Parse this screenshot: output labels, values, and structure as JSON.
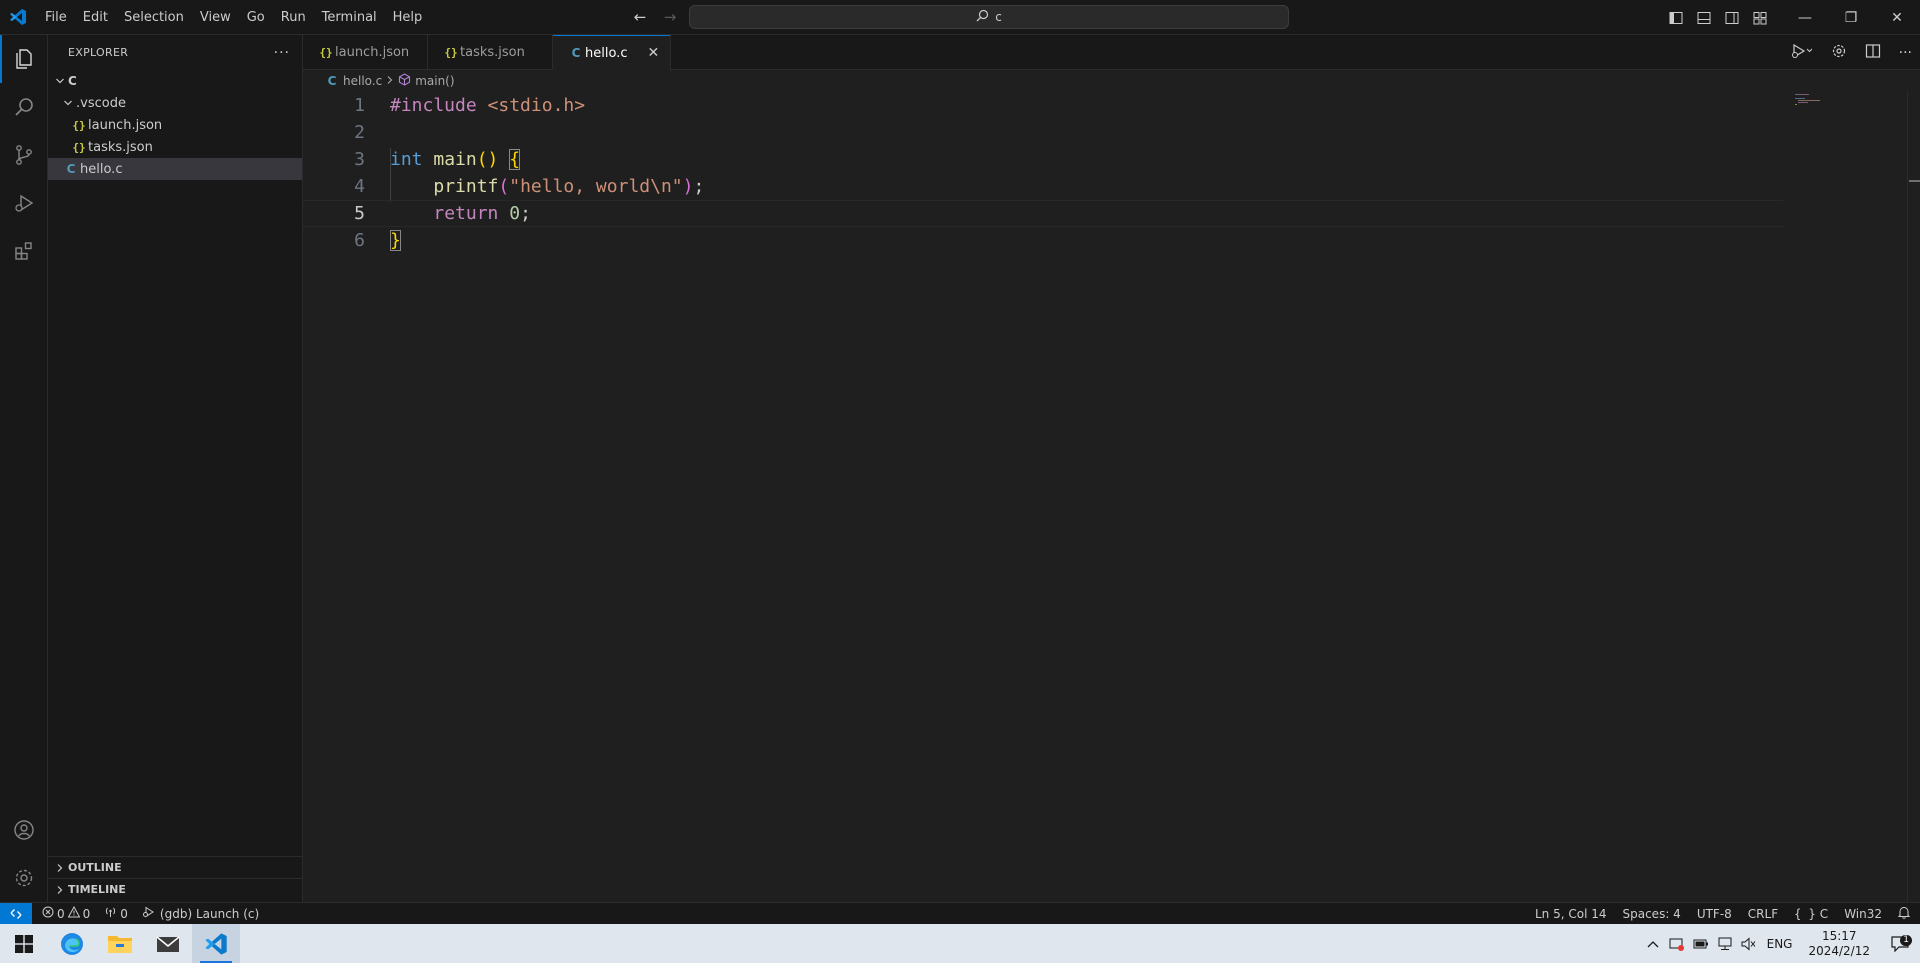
{
  "menu": [
    "File",
    "Edit",
    "Selection",
    "View",
    "Go",
    "Run",
    "Terminal",
    "Help"
  ],
  "search": {
    "value": "c"
  },
  "explorer": {
    "title": "EXPLORER",
    "root": "C",
    "folder": ".vscode",
    "files": [
      "launch.json",
      "tasks.json"
    ],
    "root_file": "hello.c",
    "outline": "OUTLINE",
    "timeline": "TIMELINE"
  },
  "tabs": [
    {
      "label": "launch.json",
      "icon": "json-icon"
    },
    {
      "label": "tasks.json",
      "icon": "json-icon"
    },
    {
      "label": "hello.c",
      "icon": "c-file-icon",
      "active": true
    }
  ],
  "breadcrumb": {
    "file": "hello.c",
    "symbol": "main()"
  },
  "editor": {
    "line_numbers": [
      "1",
      "2",
      "3",
      "4",
      "5",
      "6"
    ],
    "current_line": 5,
    "code": {
      "l1_pre": "#include",
      "l1_hdr": "<stdio.h>",
      "l3_type": "int",
      "l3_fn": "main",
      "l3_parens": "()",
      "l3_brace": "{",
      "l4_fn": "printf",
      "l4_open": "(",
      "l4_str": "\"hello, world\\n\"",
      "l4_close": ")",
      "l4_semi": ";",
      "l5_kw": "return",
      "l5_num": "0",
      "l5_semi": ";",
      "l6_brace": "}"
    }
  },
  "status": {
    "errors": "0",
    "warnings": "0",
    "ports": "0",
    "debug": "(gdb) Launch (c)",
    "position": "Ln 5, Col 14",
    "spaces": "Spaces: 4",
    "encoding": "UTF-8",
    "eol": "CRLF",
    "language": "C",
    "platform": "Win32"
  },
  "taskbar": {
    "lang": "ENG",
    "time": "15:17",
    "date": "2024/2/12",
    "notifications": "1"
  }
}
